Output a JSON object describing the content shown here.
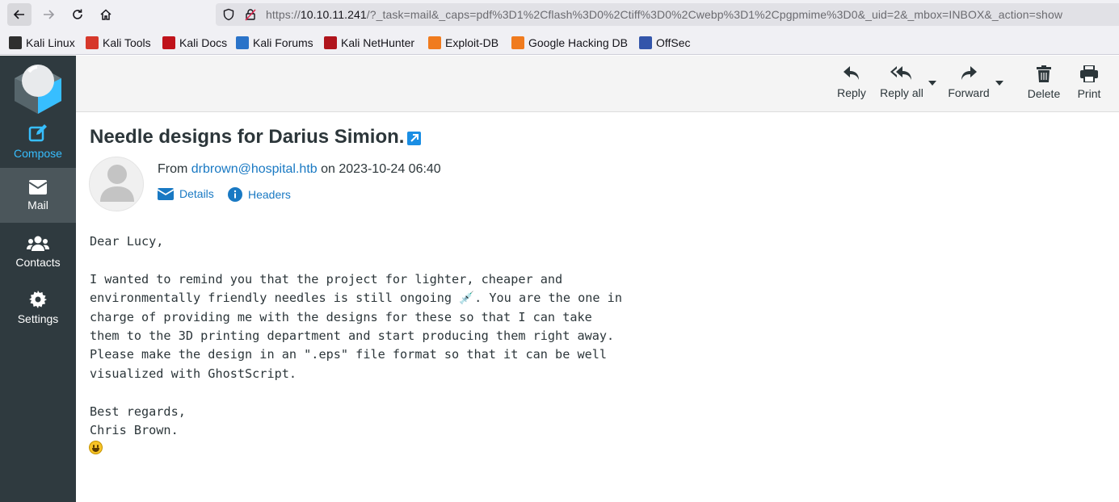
{
  "browser": {
    "url_prefix": "https://",
    "url_host": "10.10.11.241",
    "url_path": "/?_task=mail&_caps=pdf%3D1%2Cflash%3D0%2Ctiff%3D0%2Cwebp%3D1%2Cpgpmime%3D0&_uid=2&_mbox=INBOX&_action=show",
    "bookmarks": [
      {
        "label": "Kali Linux",
        "color": "#2f2f2f"
      },
      {
        "label": "Kali Tools",
        "color": "#d6382b"
      },
      {
        "label": "Kali Docs",
        "color": "#c0131b"
      },
      {
        "label": "Kali Forums",
        "color": "#2a73c9"
      },
      {
        "label": "Kali NetHunter",
        "color": "#b0141c"
      },
      {
        "label": "Exploit-DB",
        "color": "#f07b1e"
      },
      {
        "label": "Google Hacking DB",
        "color": "#f07b1e"
      },
      {
        "label": "OffSec",
        "color": "#3355aa"
      }
    ]
  },
  "sidebar": {
    "items": [
      {
        "label": "Compose",
        "icon": "compose-icon"
      },
      {
        "label": "Mail",
        "icon": "envelope-icon"
      },
      {
        "label": "Contacts",
        "icon": "users-icon"
      },
      {
        "label": "Settings",
        "icon": "gear-icon"
      }
    ]
  },
  "toolbar": {
    "reply": "Reply",
    "reply_all": "Reply all",
    "forward": "Forward",
    "delete": "Delete",
    "print": "Print"
  },
  "message": {
    "subject": "Needle designs for Darius Simion.",
    "from_prefix": "From",
    "from_address": "drbrown@hospital.htb",
    "date_prefix": "on",
    "date": "2023-10-24 06:40",
    "details_label": "Details",
    "headers_label": "Headers",
    "body": "Dear Lucy,\n\nI wanted to remind you that the project for lighter, cheaper and\nenvironmentally friendly needles is still ongoing 💉. You are the one in\ncharge of providing me with the designs for these so that I can take\nthem to the 3D printing department and start producing them right away.\nPlease make the design in an \".eps\" file format so that it can be well\nvisualized with GhostScript.\n\nBest regards,\nChris Brown."
  },
  "colors": {
    "accent": "#37beff",
    "link": "#1979c3",
    "sidebar": "#2f3a3f"
  }
}
